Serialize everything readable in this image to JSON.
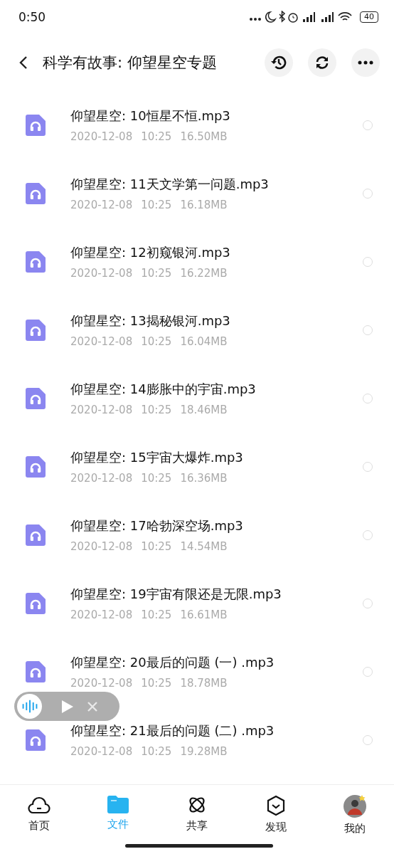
{
  "status_bar": {
    "time": "0:50",
    "battery": "40"
  },
  "header": {
    "title": "科学有故事: 仰望星空专题"
  },
  "files": [
    {
      "name": "仰望星空: 10恒星不恒.mp3",
      "date": "2020-12-08",
      "time": "10:25",
      "size": "16.50MB",
      "selected": false
    },
    {
      "name": "仰望星空: 11天文学第一问题.mp3",
      "date": "2020-12-08",
      "time": "10:25",
      "size": "16.18MB",
      "selected": false
    },
    {
      "name": "仰望星空: 12初窥银河.mp3",
      "date": "2020-12-08",
      "time": "10:25",
      "size": "16.22MB",
      "selected": false
    },
    {
      "name": "仰望星空: 13揭秘银河.mp3",
      "date": "2020-12-08",
      "time": "10:25",
      "size": "16.04MB",
      "selected": false
    },
    {
      "name": "仰望星空: 14膨胀中的宇宙.mp3",
      "date": "2020-12-08",
      "time": "10:25",
      "size": "18.46MB",
      "selected": false
    },
    {
      "name": "仰望星空: 15宇宙大爆炸.mp3",
      "date": "2020-12-08",
      "time": "10:25",
      "size": "16.36MB",
      "selected": false
    },
    {
      "name": "仰望星空: 17哈勃深空场.mp3",
      "date": "2020-12-08",
      "time": "10:25",
      "size": "14.54MB",
      "selected": false
    },
    {
      "name": "仰望星空: 19宇宙有限还是无限.mp3",
      "date": "2020-12-08",
      "time": "10:25",
      "size": "16.61MB",
      "selected": false
    },
    {
      "name": "仰望星空: 20最后的问题 (一) .mp3",
      "date": "2020-12-08",
      "time": "10:25",
      "size": "18.78MB",
      "selected": false
    },
    {
      "name": "仰望星空: 21最后的问题 (二) .mp3",
      "date": "2020-12-08",
      "time": "10:25",
      "size": "19.28MB",
      "selected": false
    }
  ],
  "nav": [
    {
      "label": "首页",
      "kind": "home",
      "selected": false
    },
    {
      "label": "文件",
      "kind": "files",
      "selected": true
    },
    {
      "label": "共享",
      "kind": "share",
      "selected": false
    },
    {
      "label": "发现",
      "kind": "discover",
      "selected": false
    },
    {
      "label": "我的",
      "kind": "me",
      "selected": false
    }
  ]
}
